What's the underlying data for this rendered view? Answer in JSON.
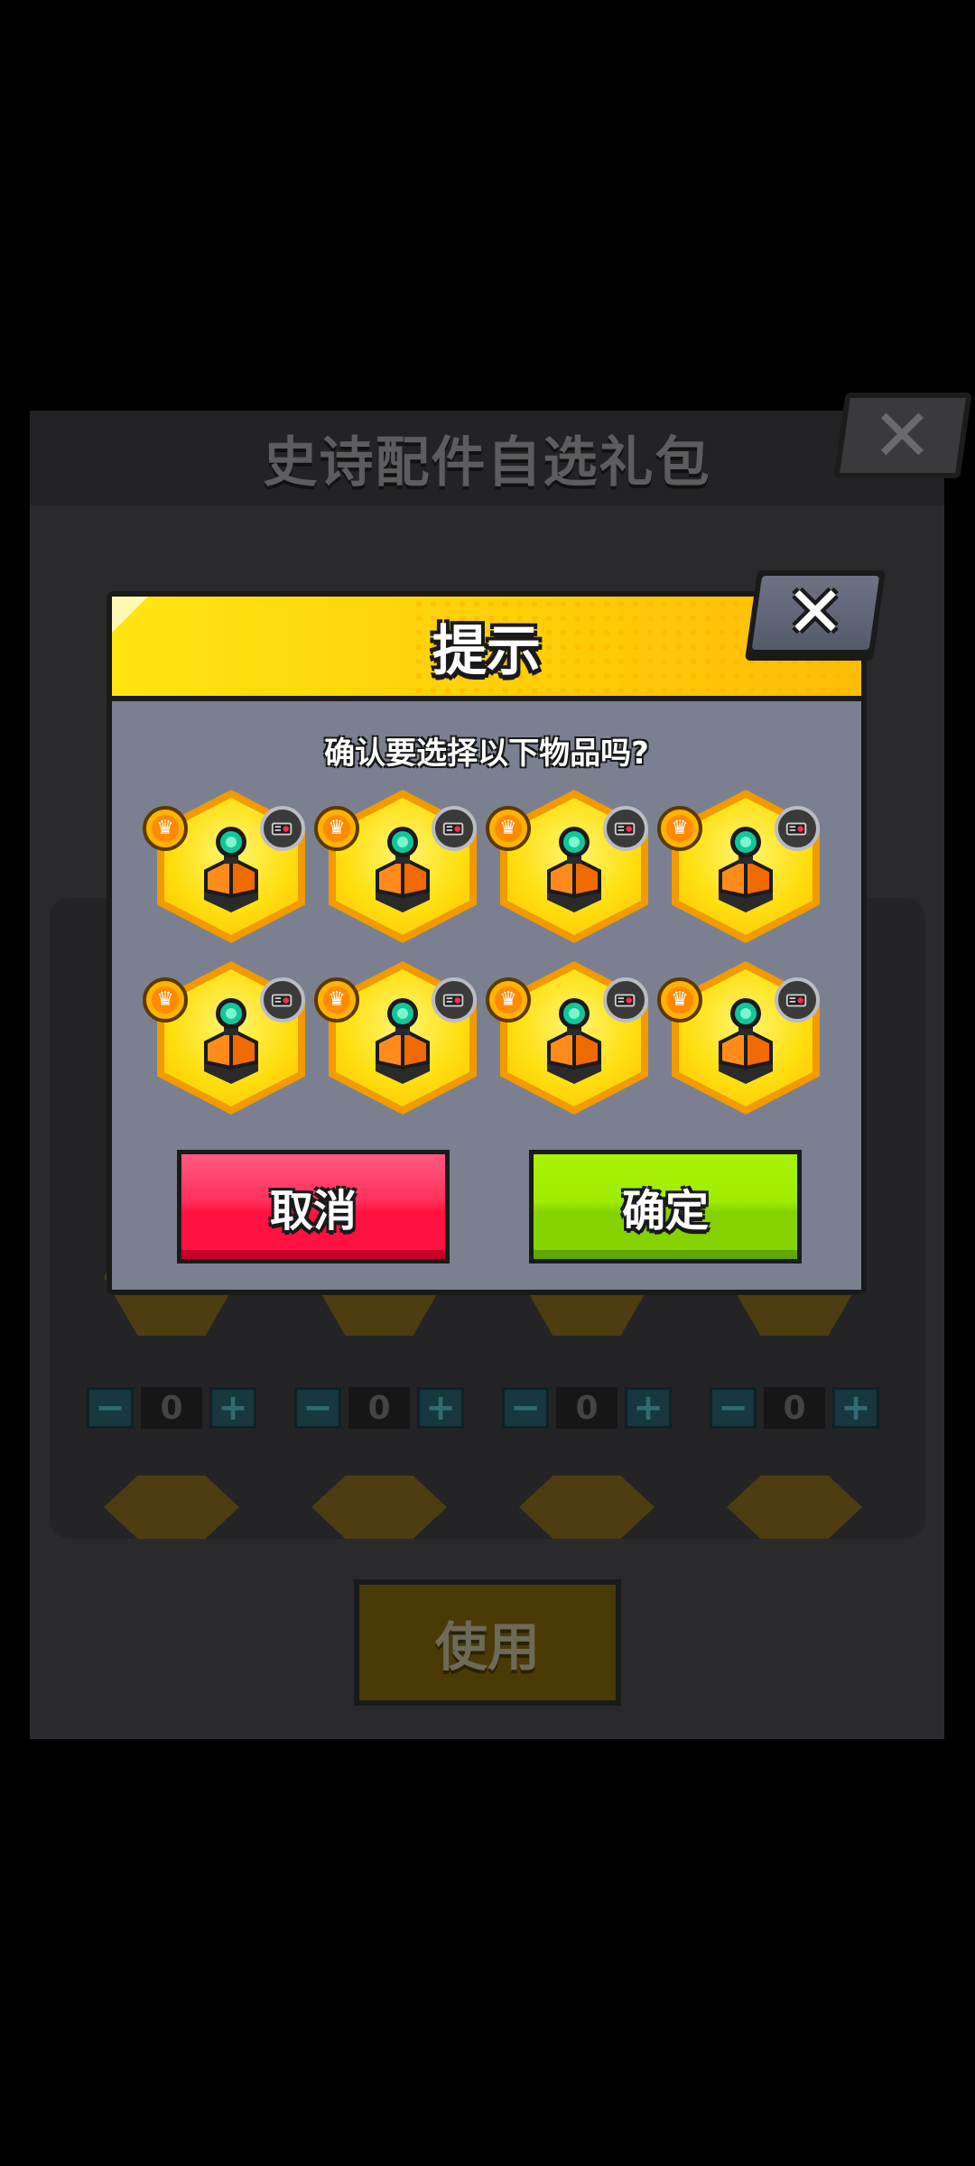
{
  "background": {
    "title": "史诗配件自选礼包",
    "close_glyph": "✕",
    "use_label": "使用",
    "steppers": [
      {
        "minus": "−",
        "value": "0",
        "plus": "+"
      },
      {
        "minus": "−",
        "value": "0",
        "plus": "+"
      },
      {
        "minus": "−",
        "value": "0",
        "plus": "+"
      },
      {
        "minus": "−",
        "value": "0",
        "plus": "+"
      }
    ]
  },
  "dialog": {
    "title": "提示",
    "close_glyph": "✕",
    "question": "确认要选择以下物品吗?",
    "items": [
      {
        "icon": "turret-part-icon",
        "rarity_icon": "crown-icon",
        "type_icon": "cannon-icon"
      },
      {
        "icon": "turret-part-icon",
        "rarity_icon": "crown-icon",
        "type_icon": "cannon-icon"
      },
      {
        "icon": "turret-part-icon",
        "rarity_icon": "crown-icon",
        "type_icon": "cannon-icon"
      },
      {
        "icon": "turret-part-icon",
        "rarity_icon": "crown-icon",
        "type_icon": "cannon-icon"
      },
      {
        "icon": "turret-part-icon",
        "rarity_icon": "crown-icon",
        "type_icon": "cannon-icon"
      },
      {
        "icon": "turret-part-icon",
        "rarity_icon": "crown-icon",
        "type_icon": "cannon-icon"
      },
      {
        "icon": "turret-part-icon",
        "rarity_icon": "crown-icon",
        "type_icon": "cannon-icon"
      },
      {
        "icon": "turret-part-icon",
        "rarity_icon": "crown-icon",
        "type_icon": "cannon-icon"
      }
    ],
    "cancel_label": "取消",
    "confirm_label": "确定"
  },
  "colors": {
    "header_yellow": "#ffd40a",
    "body_gray": "#7b8090",
    "cancel_red": "#ff1240",
    "confirm_green": "#86d200",
    "item_gold": "#ffdf10"
  }
}
